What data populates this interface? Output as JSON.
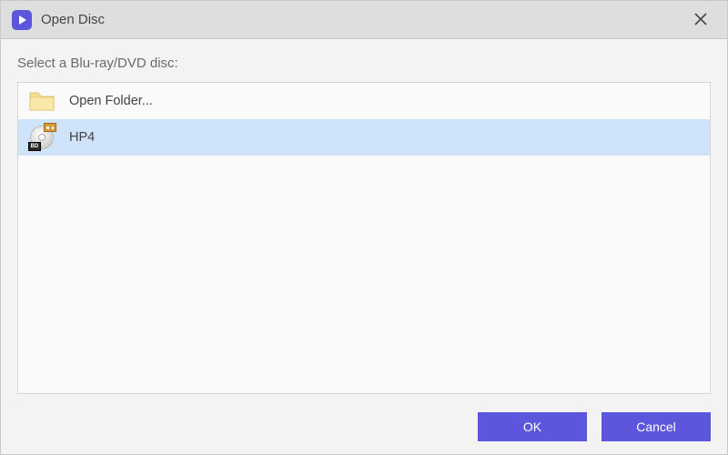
{
  "titlebar": {
    "title": "Open Disc"
  },
  "prompt": "Select a Blu-ray/DVD disc:",
  "items": [
    {
      "label": "Open Folder...",
      "icon": "folder",
      "selected": false
    },
    {
      "label": "HP4",
      "icon": "disc",
      "selected": true
    }
  ],
  "buttons": {
    "ok": "OK",
    "cancel": "Cancel"
  },
  "disc_badge": "BD"
}
